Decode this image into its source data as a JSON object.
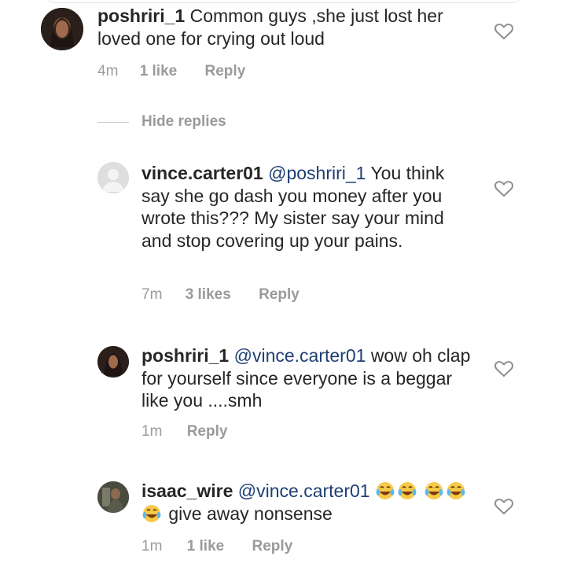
{
  "comments": [
    {
      "username": "poshriri_1",
      "mention": "",
      "text": "Common guys ,she just lost her loved one for crying out loud",
      "time": "4m",
      "likes": "1 like",
      "reply_label": "Reply"
    },
    {
      "username": "vince.carter01",
      "mention": "@poshriri_1",
      "text": "You think say she go dash you money after you wrote this??? My sister say your mind and stop covering up your pains.",
      "time": "7m",
      "likes": "3 likes",
      "reply_label": "Reply"
    },
    {
      "username": "poshriri_1",
      "mention": "@vince.carter01",
      "text": "wow oh clap for yourself since everyone is a beggar like you ....smh",
      "time": "1m",
      "likes": "",
      "reply_label": "Reply"
    },
    {
      "username": "isaac_wire",
      "mention": "@vince.carter01",
      "text": "give away nonsense",
      "time": "1m",
      "likes": "1 like",
      "reply_label": "Reply"
    }
  ],
  "hide_replies_label": "Hide replies",
  "icons": {
    "like": "heart-outline-icon",
    "laugh": "tears-of-joy-emoji"
  },
  "colors": {
    "text": "#262626",
    "meta": "#9a9a9a",
    "mention": "#1d3f74"
  }
}
